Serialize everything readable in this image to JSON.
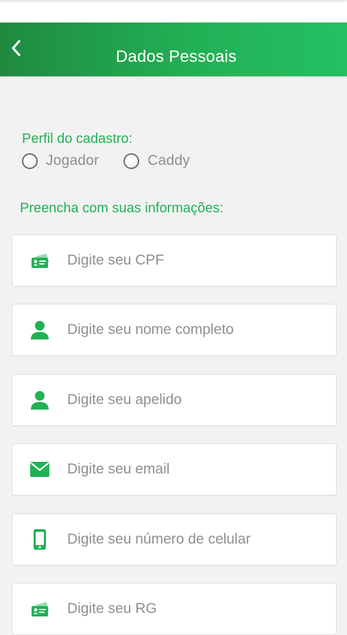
{
  "header": {
    "title": "Dados Pessoais",
    "back_icon": "chevron-left-icon"
  },
  "profile": {
    "label": "Perfil do cadastro:",
    "options": [
      {
        "label": "Jogador",
        "selected": false
      },
      {
        "label": "Caddy",
        "selected": false
      }
    ]
  },
  "form": {
    "label": "Preencha com suas informações:",
    "fields": [
      {
        "icon": "id-card-icon",
        "placeholder": "Digite seu CPF",
        "value": ""
      },
      {
        "icon": "user-icon",
        "placeholder": "Digite seu nome completo",
        "value": ""
      },
      {
        "icon": "user-icon",
        "placeholder": "Digite seu apelido",
        "value": ""
      },
      {
        "icon": "envelope-icon",
        "placeholder": "Digite seu email",
        "value": ""
      },
      {
        "icon": "mobile-phone-icon",
        "placeholder": "Digite seu número de celular",
        "value": ""
      },
      {
        "icon": "id-card-icon",
        "placeholder": "Digite seu RG",
        "value": ""
      }
    ]
  },
  "colors": {
    "header_start": "#1f8a3f",
    "header_end": "#25c063",
    "accent": "#22b155",
    "background": "#f2f2f2",
    "placeholder": "#8f8f8f"
  }
}
